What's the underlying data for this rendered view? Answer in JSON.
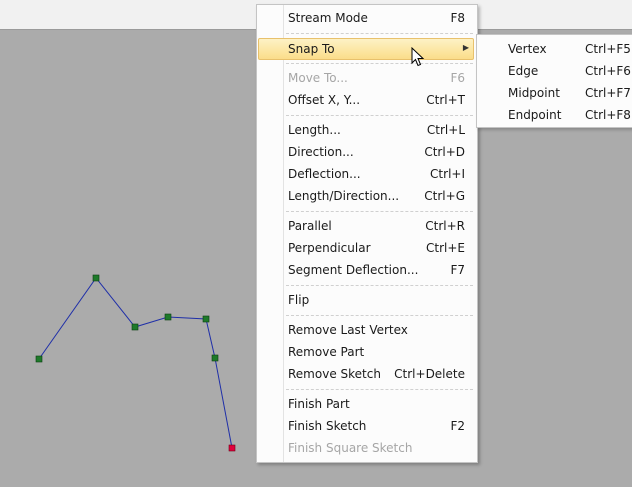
{
  "menu": {
    "items": [
      {
        "label": "Stream Mode",
        "shortcut": "F8",
        "state": "normal"
      },
      {
        "label": "Snap To",
        "shortcut": "",
        "state": "highlighted",
        "submenu": true
      },
      {
        "label": "Move To...",
        "shortcut": "F6",
        "state": "disabled"
      },
      {
        "label": "Offset X, Y...",
        "shortcut": "Ctrl+T",
        "state": "normal"
      },
      {
        "label": "Length...",
        "shortcut": "Ctrl+L",
        "state": "normal"
      },
      {
        "label": "Direction...",
        "shortcut": "Ctrl+D",
        "state": "normal"
      },
      {
        "label": "Deflection...",
        "shortcut": "Ctrl+I",
        "state": "normal"
      },
      {
        "label": "Length/Direction...",
        "shortcut": "Ctrl+G",
        "state": "normal"
      },
      {
        "label": "Parallel",
        "shortcut": "Ctrl+R",
        "state": "normal"
      },
      {
        "label": "Perpendicular",
        "shortcut": "Ctrl+E",
        "state": "normal"
      },
      {
        "label": "Segment Deflection...",
        "shortcut": "F7",
        "state": "normal"
      },
      {
        "label": "Flip",
        "shortcut": "",
        "state": "normal"
      },
      {
        "label": "Remove Last Vertex",
        "shortcut": "",
        "state": "normal"
      },
      {
        "label": "Remove Part",
        "shortcut": "",
        "state": "normal"
      },
      {
        "label": "Remove Sketch",
        "shortcut": "Ctrl+Delete",
        "state": "normal"
      },
      {
        "label": "Finish Part",
        "shortcut": "",
        "state": "normal"
      },
      {
        "label": "Finish Sketch",
        "shortcut": "F2",
        "state": "normal"
      },
      {
        "label": "Finish Square Sketch",
        "shortcut": "",
        "state": "disabled"
      }
    ]
  },
  "submenu": {
    "items": [
      {
        "label": "Vertex",
        "shortcut": "Ctrl+F5"
      },
      {
        "label": "Edge",
        "shortcut": "Ctrl+F6"
      },
      {
        "label": "Midpoint",
        "shortcut": "Ctrl+F7"
      },
      {
        "label": "Endpoint",
        "shortcut": "Ctrl+F8"
      }
    ]
  },
  "icons": {
    "submenu_arrow": "triangle-right-icon",
    "cursor": "arrow-cursor-icon"
  },
  "colors": {
    "highlight_top": "#fdf2c5",
    "highlight_bottom": "#fbdd8a",
    "sketch_line": "#1f2fa8",
    "vertex_fill": "#1e7a2a",
    "last_vertex_fill": "#e0003c",
    "canvas_bg": "#ababab"
  }
}
